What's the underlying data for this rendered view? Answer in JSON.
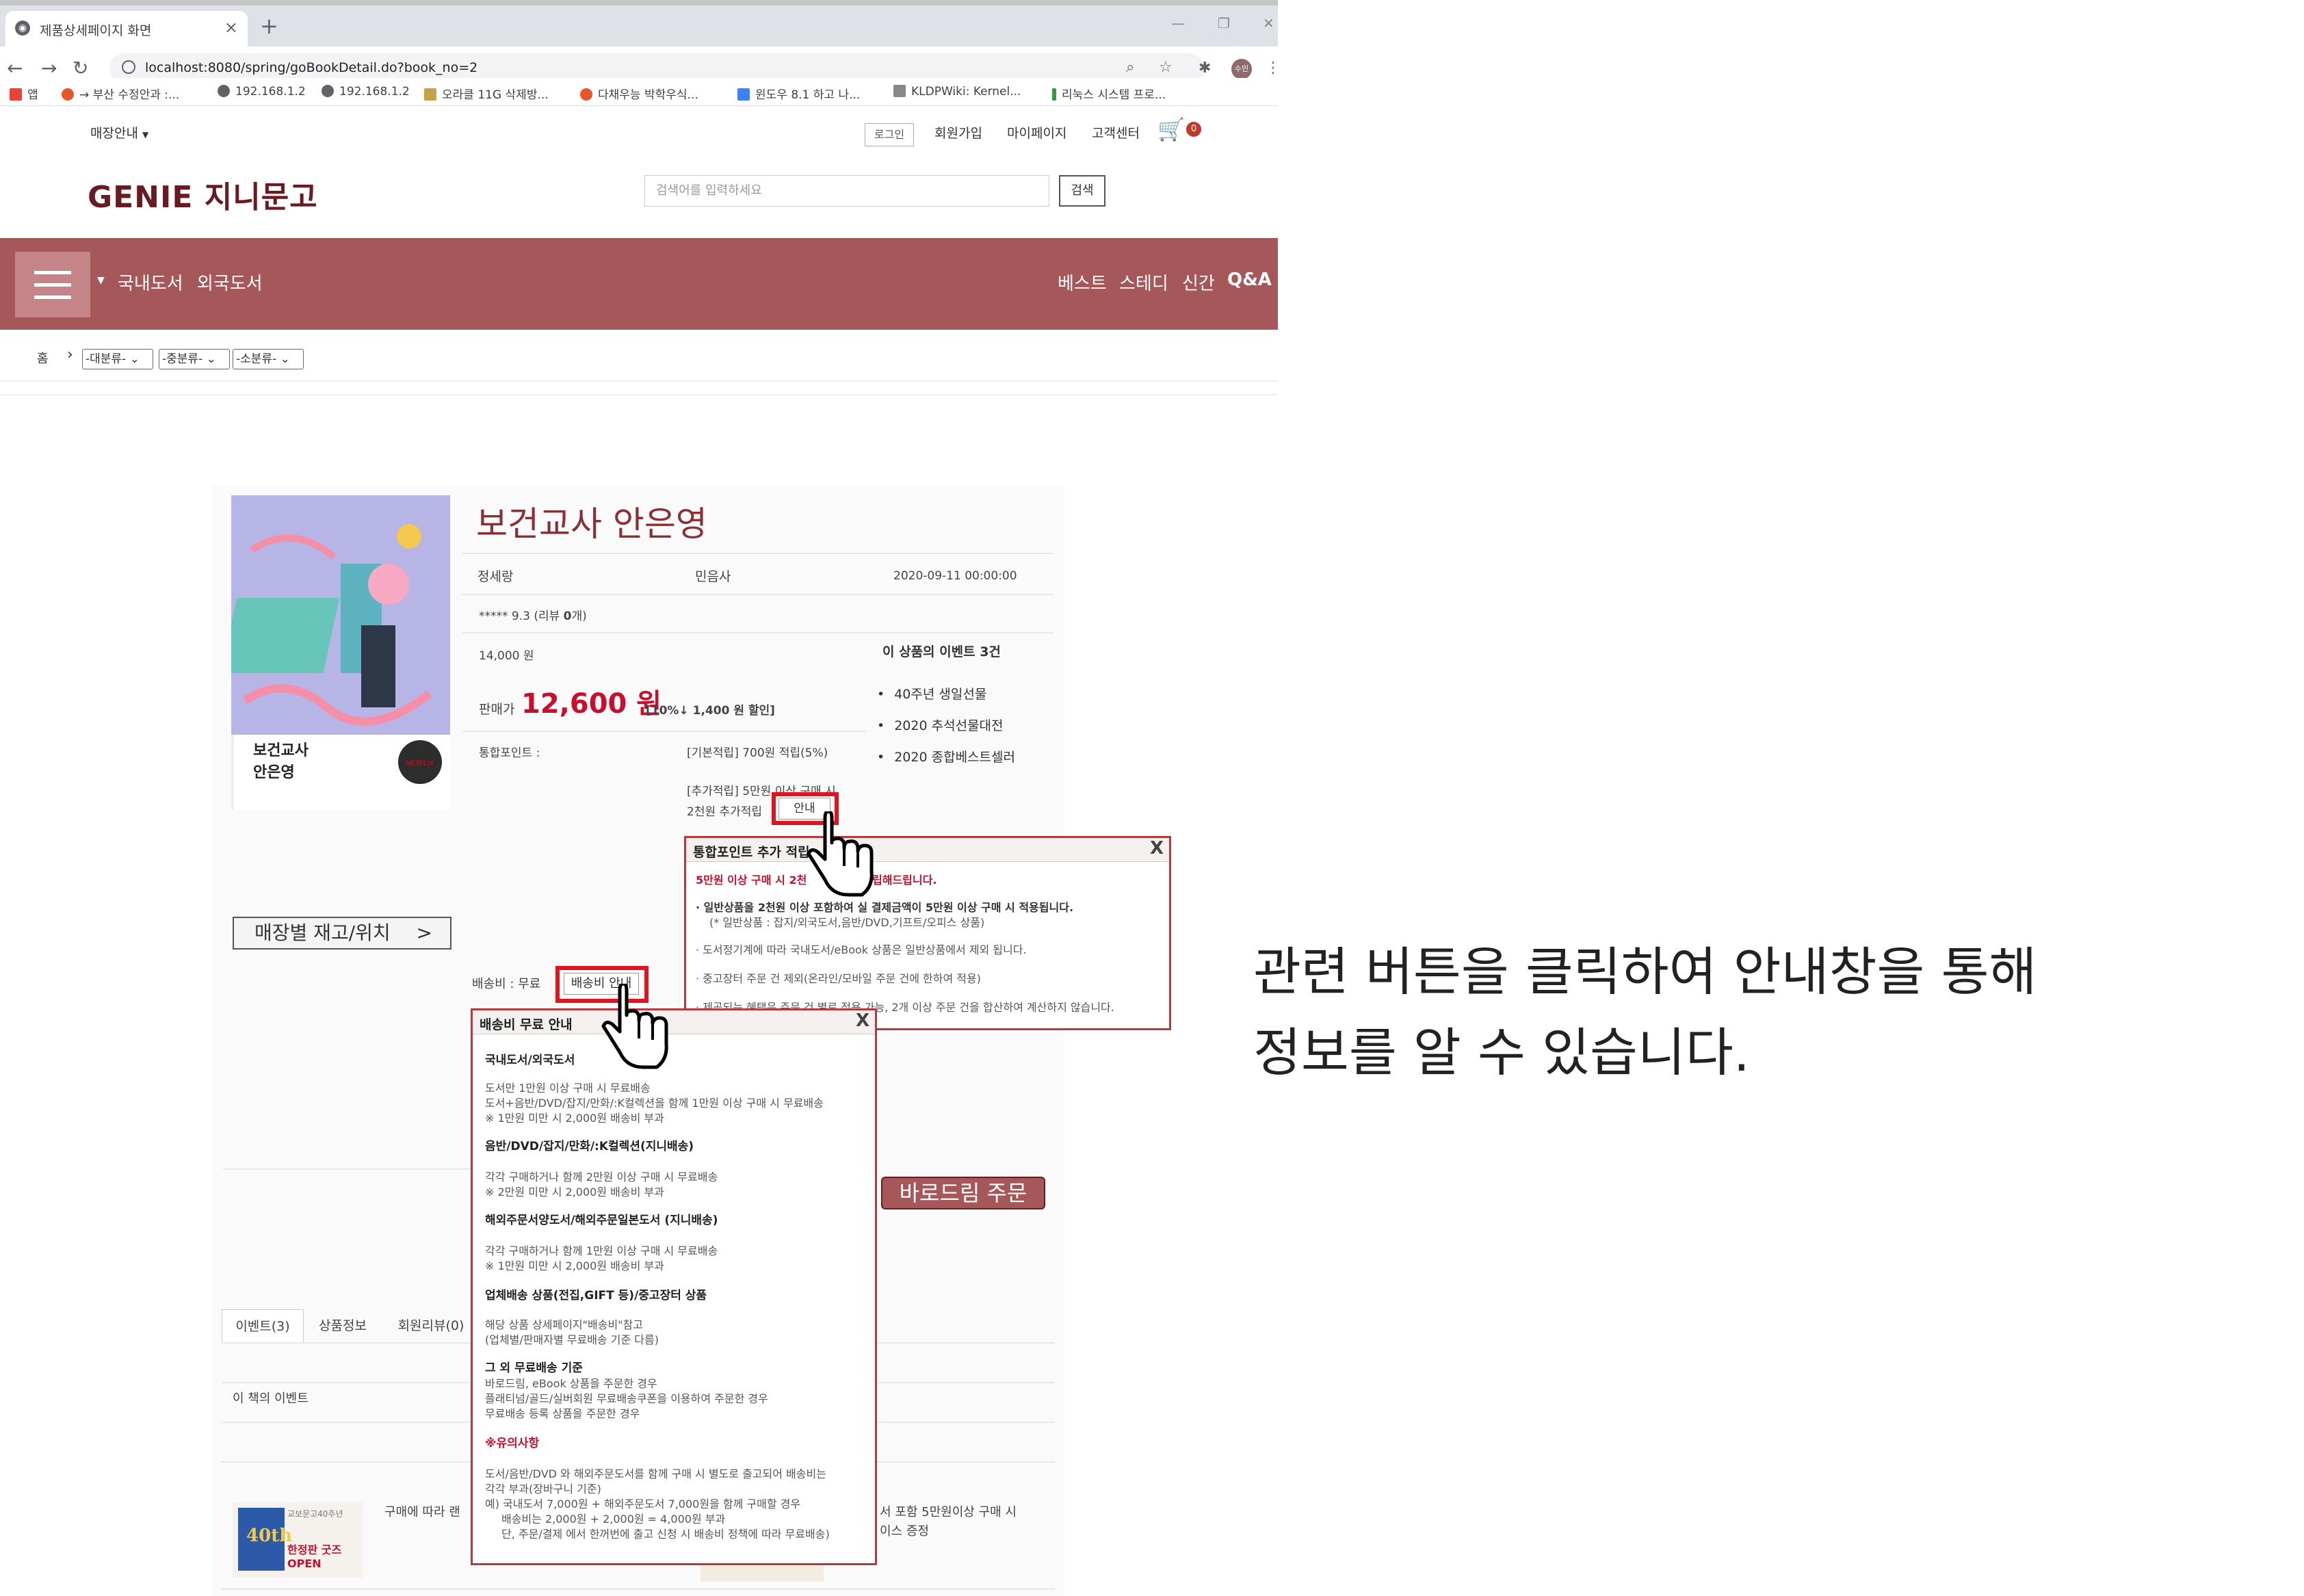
{
  "browser": {
    "tab_title": "제품상세페이지 화면",
    "url": "localhost:8080/spring/goBookDetail.do?book_no=2",
    "bookmarks": [
      "앱",
      "→ 부산 수정안과 :...",
      "192.168.1.2",
      "192.168.1.2",
      "오라클 11G 삭제방...",
      "다채우능 박학우식...",
      "윈도우 8.1 하고 나...",
      "KLDPWiki: Kernel...",
      "리눅스 시스템 프로..."
    ],
    "profile_initial": "수민"
  },
  "header": {
    "store_menu": "매장안내",
    "login": "로그인",
    "signup": "회원가입",
    "mypage": "마이페이지",
    "support": "고객센터",
    "cart_count": "0",
    "logo": "GENIE 지니문고",
    "search_placeholder": "검색어를 입력하세요",
    "search_button": "검색"
  },
  "gnb": {
    "left": [
      "국내도서",
      "외국도서"
    ],
    "right": [
      "베스트",
      "스테디",
      "신간",
      "Q&A"
    ]
  },
  "breadcrumb": {
    "home": "홈",
    "selects": [
      "-대분류-",
      "-중분류-",
      "-소분류-"
    ]
  },
  "product": {
    "title": "보건교사 안은영",
    "author": "정세랑",
    "publisher": "민음사",
    "date": "2020-09-11 00:00:00",
    "rating_prefix": "***** 9.3 (리뷰 ",
    "rating_count": "0",
    "rating_suffix": "개)",
    "list_price": "14,000 원",
    "sale_label": "판매가",
    "sale_price": "12,600 원",
    "discount": "[10%↓ 1,400 원 할인]",
    "points_label": "통합포인트 :",
    "points_base": "[기본적립] 700원 적립(5%)",
    "points_extra_1": "[추가적립] 5만원 이상 구매 시",
    "points_extra_2": "2천원 추가적립",
    "guide_button": "안내",
    "store_button": "매장별 재고/위치",
    "shipping_label": "배송비 : 무료",
    "shipping_button": "배송비 안내",
    "order_button": "바로드림 주문",
    "cover_title_1": "보건교사",
    "cover_title_2": "안은영",
    "cover_badge": "NETFLIX"
  },
  "events": {
    "title": "이 상품의 이벤트 3건",
    "items": [
      "40주년 생일선물",
      "2020 추석선물대전",
      "2020 종합베스트셀러"
    ]
  },
  "tabs": [
    "이벤트(3)",
    "상품정보",
    "회원리뷰(0)"
  ],
  "lower": {
    "section_title": "이 책의 이벤트",
    "event_text_left": "구매에 따라 랜",
    "event_text_right_1": "서 포함 5만원이상 구매 시",
    "event_text_right_2": "이스 증정",
    "banner_small": "교보문고40주년",
    "banner_big": "40th",
    "banner_sub": "한정판 굿즈 OPEN"
  },
  "points_popup": {
    "title": "통합포인트 추가 적립",
    "highlight": "5만원 이상 구매 시 2천",
    "highlight_end": "립해드립니다.",
    "lines": [
      "· 일반상품을 2천원 이상 포함하여 실 결제금액이 5만원 이상 구매 시 적용됩니다.",
      "(* 일반상품 : 잡지/외국도서,음반/DVD,기프트/오피스 상품)",
      "· 도서정기계에 따라 국내도서/eBook 상품은 일반상품에서 제외 됩니다.",
      "· 중고장터 주문 건 제외(온라인/모바일 주문 건에 한하여 적용)",
      "· 제공되는 혜택은 주문 건 별로 적용 가능, 2개 이상 주문 건을 합산하여 계산하지 않습니다."
    ]
  },
  "shipping_popup": {
    "title": "배송비 무료 안내",
    "sections": [
      {
        "head": "국내도서/외국도서",
        "lines": [
          "도서만 1만원 이상 구매 시 무료배송",
          "도서+음반/DVD/잡지/만화/:K컬렉션을 함께 1만원 이상 구매 시 무료배송",
          "※ 1만원 미만 시 2,000원 배송비 부과"
        ]
      },
      {
        "head": "음반/DVD/잡지/만화/:K컬렉션(지니배송)",
        "lines": [
          "각각 구매하거나 함께 2만원 이상 구매 시 무료배송",
          "※ 2만원 미만 시 2,000원 배송비 부과"
        ]
      },
      {
        "head": "해외주문서양도서/해외주문일본도서 (지니배송)",
        "lines": [
          "각각 구매하거나 함께 1만원 이상 구매 시 무료배송",
          "※ 1만원 미만 시 2,000원 배송비 부과"
        ]
      },
      {
        "head": "업체배송 상품(전집,GIFT 등)/중고장터 상품",
        "lines": [
          "해당 상품 상세페이지\"배송비\"참고",
          "(업체별/판매자별 무료배송 기준 다름)"
        ]
      },
      {
        "head": "그 외 무료배송 기준",
        "lines": [
          "바로드림, eBook 상품을 주문한 경우",
          "플래티넘/골드/실버회원 무료배송쿠폰을 이용하여 주문한 경우",
          "무료배송 등록 상품을 주문한 경우"
        ]
      }
    ],
    "warning_head": "※유의사항",
    "warning_lines": [
      "도서/음반/DVD 와 해외주문도서를 함께 구매 시 별도로 출고되어 배송비는",
      "각각 부과(장바구니 기준)",
      "예) 국내도서 7,000원 + 해외주문도서 7,000원을 함께 구매할 경우",
      "배송비는 2,000원 + 2,000원 = 4,000원 부과",
      "단, 주문/결제 에서 한꺼번에 출고 신청 시 배송비 정책에 따라 무료배송)"
    ]
  },
  "caption": {
    "line1": "관련 버튼을 클릭하여 안내창을 통해",
    "line2": "정보를 알 수 있습니다."
  },
  "colors": {
    "brand": "#6b1a22",
    "gnb": "#a5575a",
    "price": "#c8102e",
    "highlight_box": "#e0141e"
  }
}
